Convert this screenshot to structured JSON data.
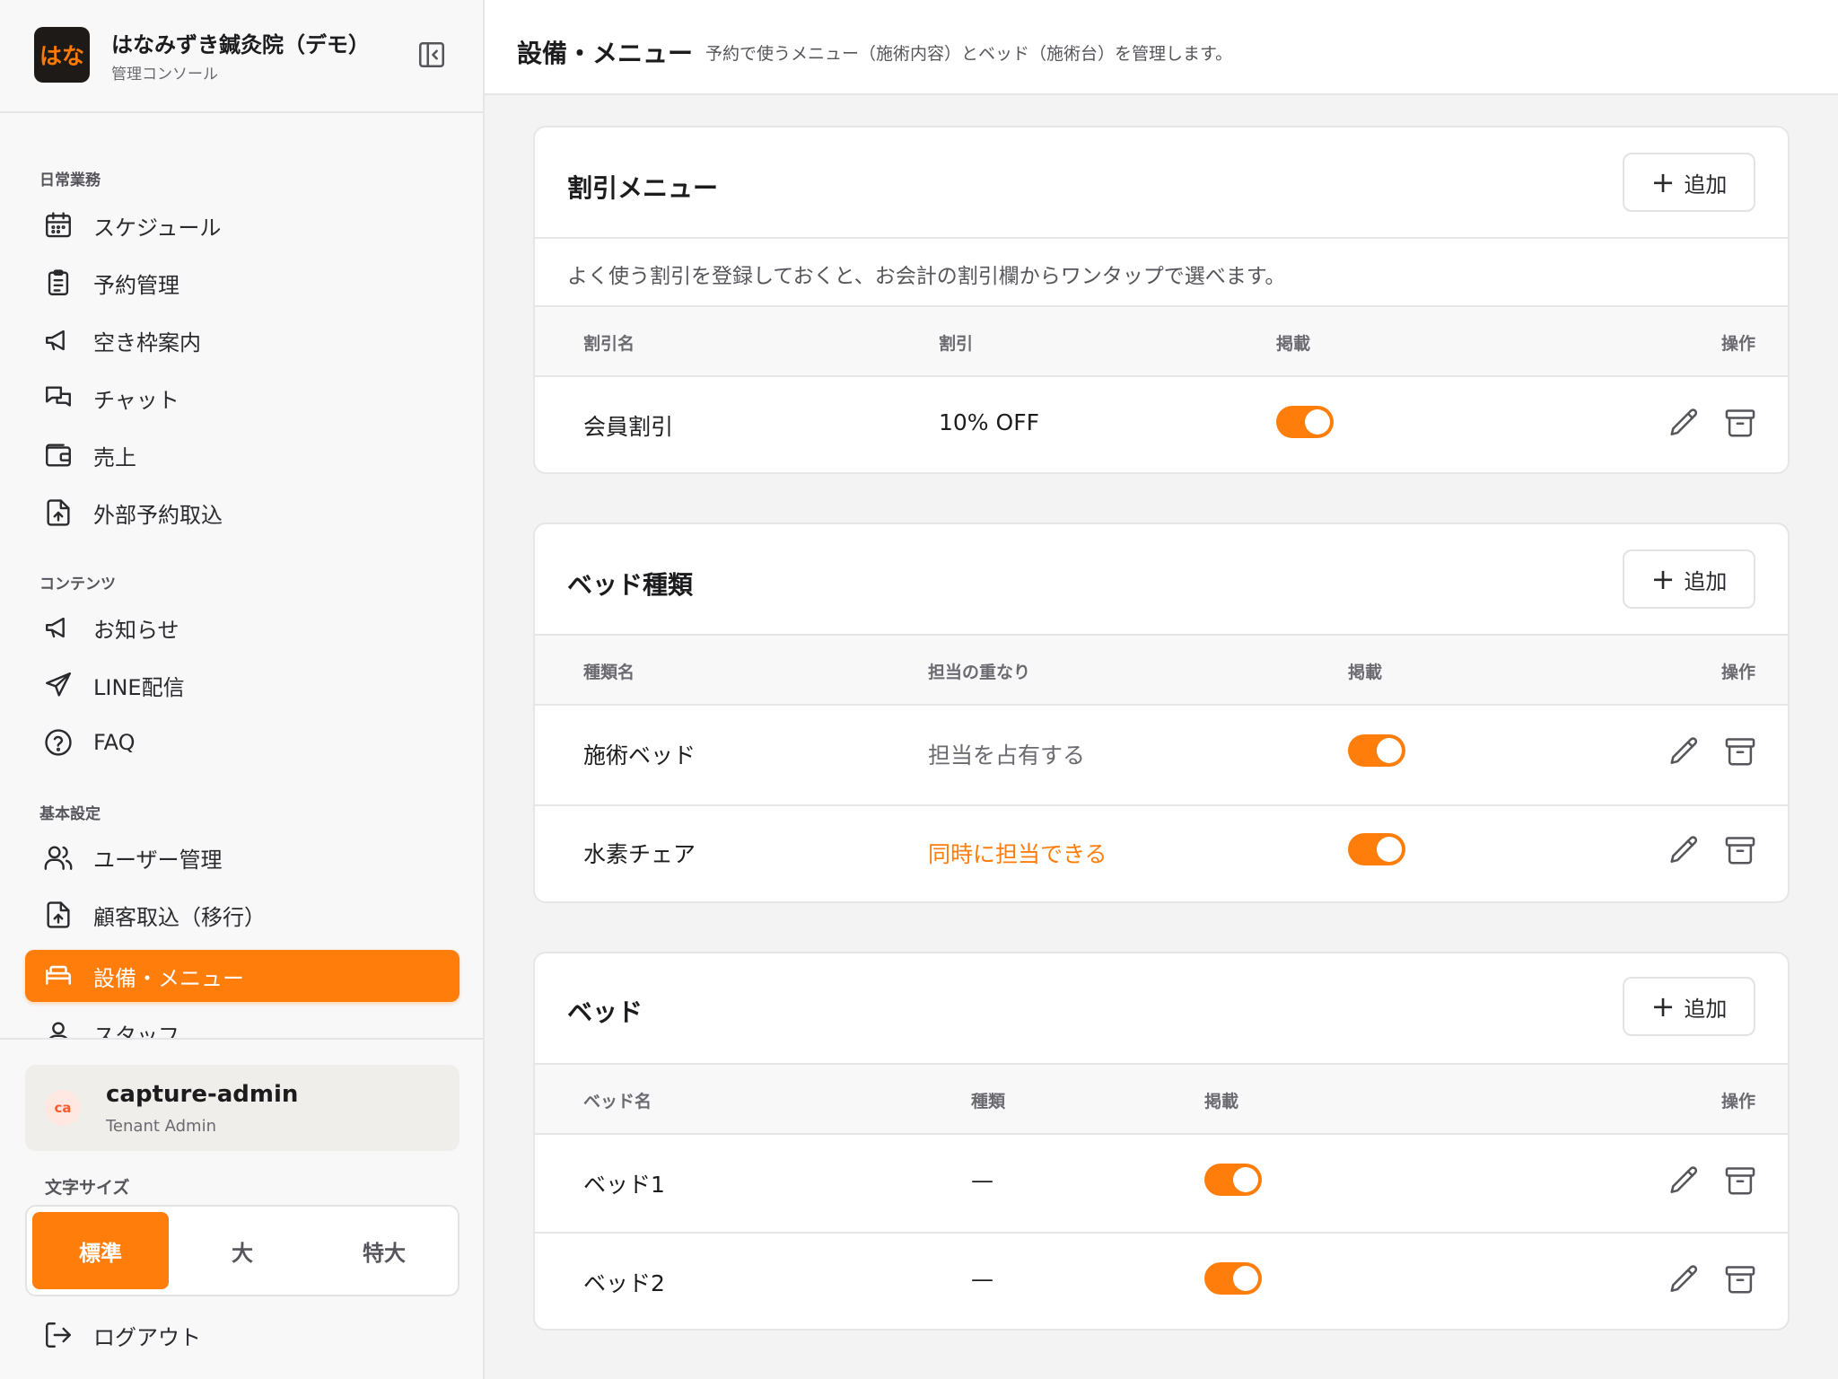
{
  "brand": {
    "logo_text": "はな",
    "title": "はなみずき鍼灸院（デモ）",
    "subtitle": "管理コンソール"
  },
  "sidebar": {
    "sections": [
      "日常業務",
      "コンテンツ",
      "基本設定"
    ],
    "items": [
      {
        "label": "スケジュール",
        "icon": "calendar-icon"
      },
      {
        "label": "予約管理",
        "icon": "clipboard-list-icon"
      },
      {
        "label": "空き枠案内",
        "icon": "megaphone-icon"
      },
      {
        "label": "チャット",
        "icon": "chat-bubbles-icon"
      },
      {
        "label": "売上",
        "icon": "wallet-icon"
      },
      {
        "label": "外部予約取込",
        "icon": "file-upload-icon"
      },
      {
        "label": "お知らせ",
        "icon": "megaphone-icon"
      },
      {
        "label": "LINE配信",
        "icon": "send-icon"
      },
      {
        "label": "FAQ",
        "icon": "help-circle-icon"
      },
      {
        "label": "ユーザー管理",
        "icon": "users-icon"
      },
      {
        "label": "顧客取込（移行）",
        "icon": "file-upload-icon"
      },
      {
        "label": "設備・メニュー",
        "icon": "bed-icon",
        "active": true
      },
      {
        "label": "スタッフ",
        "icon": "user-icon"
      }
    ]
  },
  "user": {
    "initials": "ca",
    "name": "capture-admin",
    "role": "Tenant Admin"
  },
  "font_size": {
    "label": "文字サイズ",
    "options": [
      "標準",
      "大",
      "特大"
    ],
    "selected": "標準"
  },
  "logout_label": "ログアウト",
  "header": {
    "title": "設備・メニュー",
    "description": "予約で使うメニュー（施術内容）とベッド（施術台）を管理します。"
  },
  "add_label": "追加",
  "discounts": {
    "title": "割引メニュー",
    "note": "よく使う割引を登録しておくと、お会計の割引欄からワンタップで選べます。",
    "columns": [
      "割引名",
      "割引",
      "掲載",
      "操作"
    ],
    "rows": [
      {
        "name": "会員割引",
        "discount": "10% OFF",
        "published": true
      }
    ]
  },
  "bed_types": {
    "title": "ベッド種類",
    "columns": [
      "種類名",
      "担当の重なり",
      "掲載",
      "操作"
    ],
    "rows": [
      {
        "name": "施術ベッド",
        "overlap": "担当を占有する",
        "published": true
      },
      {
        "name": "水素チェア",
        "overlap": "同時に担当できる",
        "published": true
      }
    ]
  },
  "beds": {
    "title": "ベッド",
    "columns": [
      "ベッド名",
      "種類",
      "掲載",
      "操作"
    ],
    "rows": [
      {
        "name": "ベッド1",
        "type": "—",
        "published": true
      },
      {
        "name": "ベッド2",
        "type": "—",
        "published": true
      }
    ]
  },
  "colors": {
    "accent": "#ff7d0a",
    "sidebar_bg": "#f8f8f9",
    "page_bg": "#f3f3f4"
  }
}
